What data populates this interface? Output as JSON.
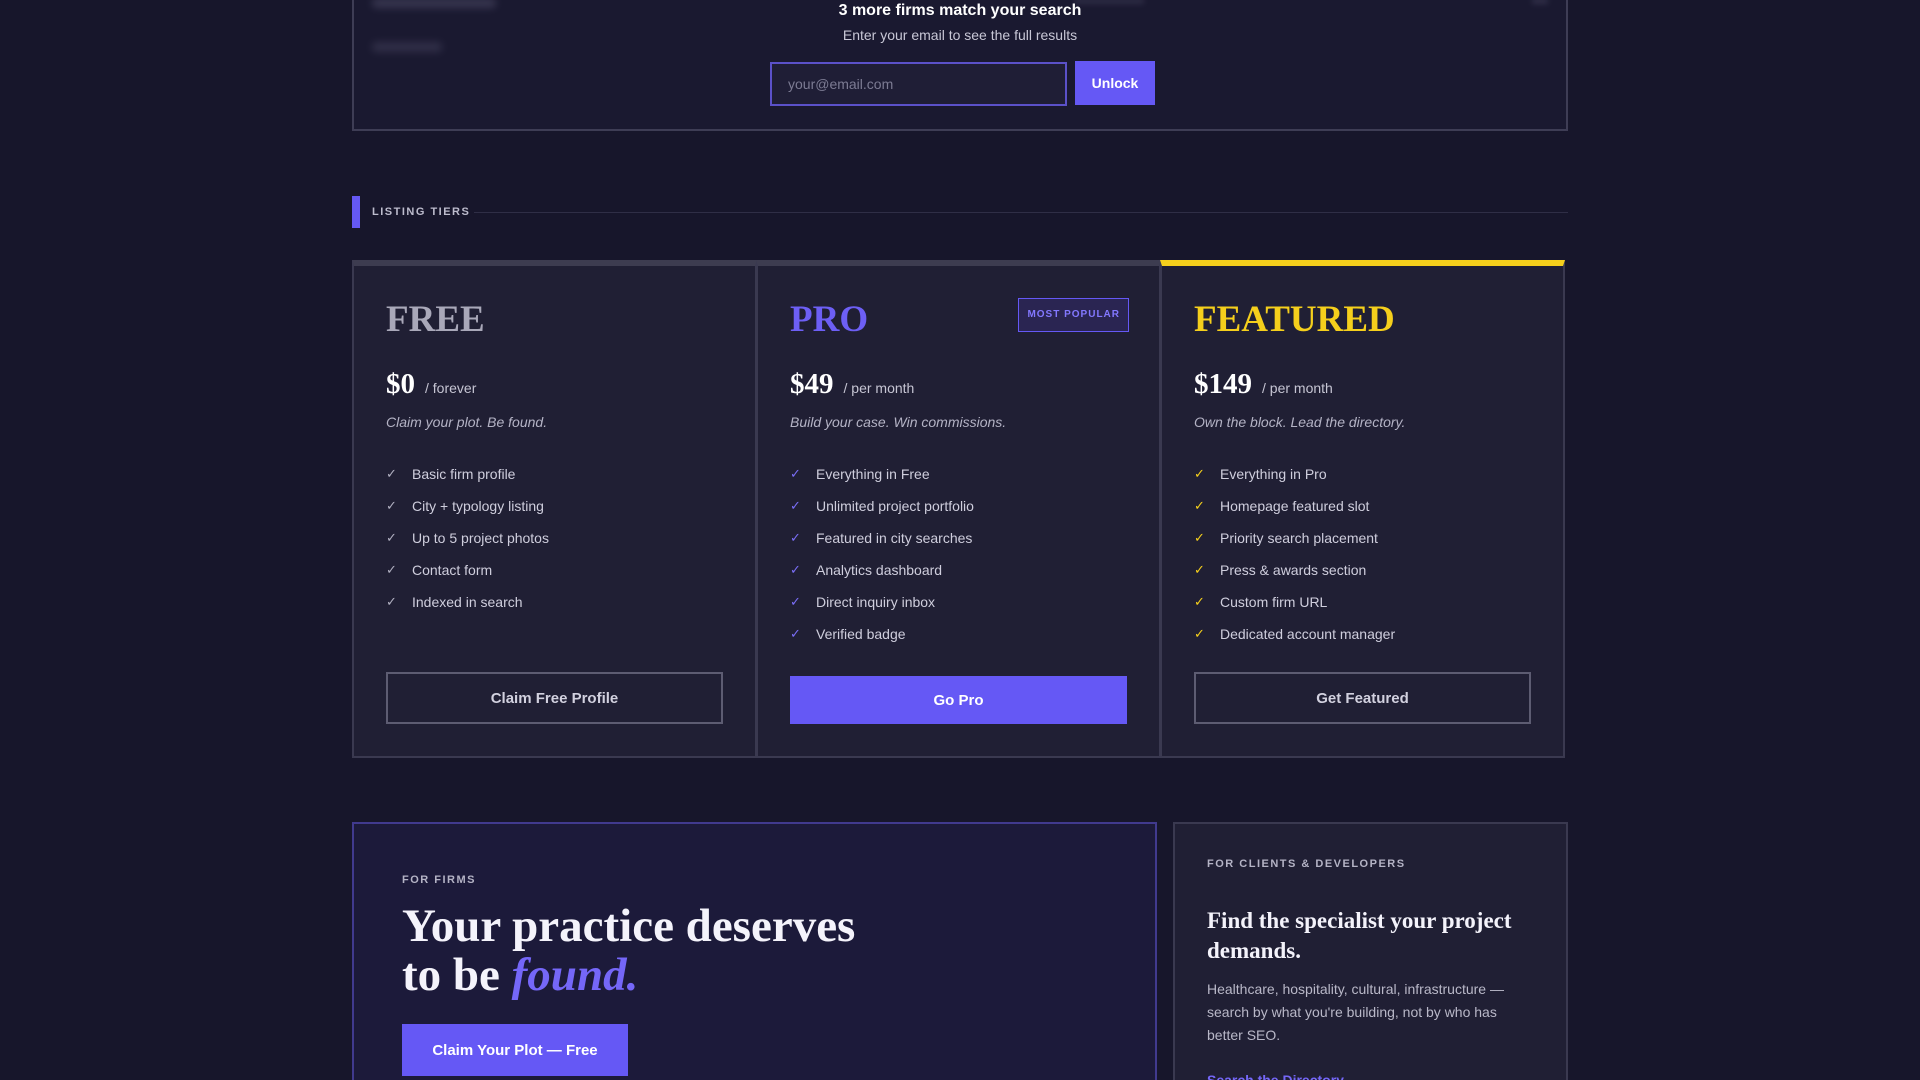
{
  "gate": {
    "title": "3 more firms match your search",
    "subtitle": "Enter your email to see the full results",
    "email_placeholder": "your@email.com",
    "unlock_label": "Unlock"
  },
  "listing_section": {
    "label": "LISTING TIERS"
  },
  "tiers": [
    {
      "name": "FREE",
      "price": "$0",
      "period": "/ forever",
      "tagline": "Claim your plot. Be found.",
      "features": [
        "Basic firm profile",
        "City + typology listing",
        "Up to 5 project photos",
        "Contact form",
        "Indexed in search"
      ],
      "cta": "Claim Free Profile",
      "accent": "#a9a8b9"
    },
    {
      "name": "PRO",
      "badge": "MOST POPULAR",
      "price": "$49",
      "period": "/ per month",
      "tagline": "Build your case. Win commissions.",
      "features": [
        "Everything in Free",
        "Unlimited project portfolio",
        "Featured in city searches",
        "Analytics dashboard",
        "Direct inquiry inbox",
        "Verified badge"
      ],
      "cta": "Go Pro",
      "accent": "#6558f5"
    },
    {
      "name": "FEATURED",
      "price": "$149",
      "period": "/ per month",
      "tagline": "Own the block. Lead the directory.",
      "features": [
        "Everything in Pro",
        "Homepage featured slot",
        "Priority search placement",
        "Press & awards section",
        "Custom firm URL",
        "Dedicated account manager"
      ],
      "cta": "Get Featured",
      "accent": "#f5cf1c"
    }
  ],
  "firms_card": {
    "eyebrow": "FOR FIRMS",
    "title_line1": "Your practice deserves",
    "title_line2_prefix": "to be ",
    "title_emphasis": "found.",
    "cta": "Claim Your Plot — Free"
  },
  "clients_card": {
    "eyebrow": "FOR CLIENTS & DEVELOPERS",
    "title": "Find the specialist your project demands.",
    "description": "Healthcare, hospitality, cultural, infrastructure — search by what you're building, not by who has better SEO.",
    "link": "Search the Directory →"
  },
  "colors": {
    "background": "#17162b",
    "primary": "#6558f5",
    "featured_gold": "#f5cf1c"
  }
}
